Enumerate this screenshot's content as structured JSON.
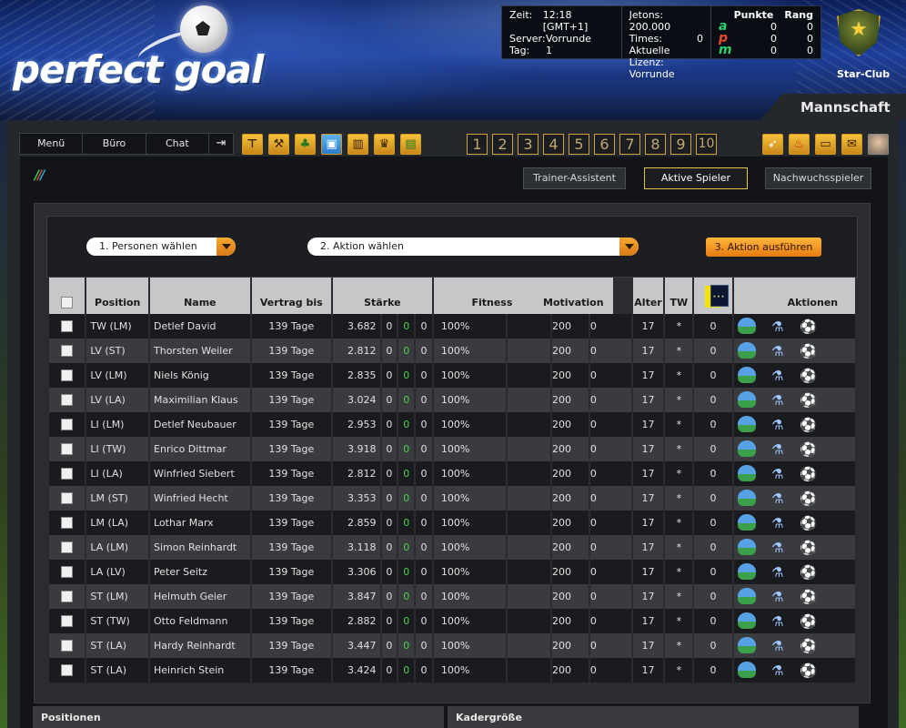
{
  "header": {
    "logo_text": "perfect goal",
    "info": {
      "time_label": "Zeit:",
      "time_value": "12:18 [GMT+1]",
      "server_label": "Server:",
      "server_value": "Vorrunde",
      "day_label": "Tag:",
      "day_value": "1",
      "chips_label": "Jetons:",
      "chips_value": "200.000",
      "times_label": "Times:",
      "times_value": "0",
      "license_label": "Aktuelle Lizenz:",
      "license_value": "Vorrunde",
      "points_header": "Punkte",
      "rank_header": "Rang",
      "scores": [
        {
          "letter": "a",
          "color": "#2bd26a",
          "points": "0",
          "rank": "0"
        },
        {
          "letter": "p",
          "color": "#e84b2a",
          "points": "0",
          "rank": "0"
        },
        {
          "letter": "m",
          "color": "#2bd26a",
          "points": "0",
          "rank": "0"
        }
      ]
    },
    "club_name": "Star-Club",
    "section_title": "Mannschaft"
  },
  "menubar": {
    "items": [
      "Menü",
      "Büro",
      "Chat"
    ],
    "logout_icon": "logout-icon"
  },
  "tool_icons": [
    "whistle-icon",
    "construction-icon",
    "clover-icon",
    "gift-icon",
    "buildings-icon",
    "crown-icon",
    "scoreboard-icon"
  ],
  "num_tabs": [
    "1",
    "2",
    "3",
    "4",
    "5",
    "6",
    "7",
    "8",
    "9",
    "10"
  ],
  "right_icons": [
    "rocket-icon",
    "fire-icon",
    "card-icon",
    "mail-icon",
    "avatar-icon"
  ],
  "sub_tabs": {
    "trainer": "Trainer-Assistent",
    "active": "Aktive Spieler",
    "youth": "Nachwuchsspieler"
  },
  "actions": {
    "select_persons": "1. Personen wählen",
    "select_action": "2. Aktion wählen",
    "execute": "3. Aktion ausführen"
  },
  "table": {
    "headers": {
      "position": "Position",
      "name": "Name",
      "contract": "Vertrag bis",
      "strength": "Stärke",
      "fitness": "Fitness",
      "motivation": "Motivation",
      "age": "Alter",
      "tw": "TW",
      "actions": "Aktionen"
    },
    "rows": [
      {
        "pos": "TW (LM)",
        "name": "Detlef David",
        "contract": "139 Tage",
        "st": "3.682",
        "s1": "0",
        "s2": "0",
        "s3": "0",
        "fit": "100%",
        "mot": "200",
        "mot2": "0",
        "age": "17",
        "tw": "*",
        "card": "0"
      },
      {
        "pos": "LV (ST)",
        "name": "Thorsten Weiler",
        "contract": "139 Tage",
        "st": "2.812",
        "s1": "0",
        "s2": "0",
        "s3": "0",
        "fit": "100%",
        "mot": "200",
        "mot2": "0",
        "age": "17",
        "tw": "*",
        "card": "0"
      },
      {
        "pos": "LV (LM)",
        "name": "Niels König",
        "contract": "139 Tage",
        "st": "2.835",
        "s1": "0",
        "s2": "0",
        "s3": "0",
        "fit": "100%",
        "mot": "200",
        "mot2": "0",
        "age": "17",
        "tw": "*",
        "card": "0"
      },
      {
        "pos": "LV (LA)",
        "name": "Maximilian Klaus",
        "contract": "139 Tage",
        "st": "3.024",
        "s1": "0",
        "s2": "0",
        "s3": "0",
        "fit": "100%",
        "mot": "200",
        "mot2": "0",
        "age": "17",
        "tw": "*",
        "card": "0"
      },
      {
        "pos": "LI (LM)",
        "name": "Detlef Neubauer",
        "contract": "139 Tage",
        "st": "2.953",
        "s1": "0",
        "s2": "0",
        "s3": "0",
        "fit": "100%",
        "mot": "200",
        "mot2": "0",
        "age": "17",
        "tw": "*",
        "card": "0"
      },
      {
        "pos": "LI (TW)",
        "name": "Enrico Dittmar",
        "contract": "139 Tage",
        "st": "3.918",
        "s1": "0",
        "s2": "0",
        "s3": "0",
        "fit": "100%",
        "mot": "200",
        "mot2": "0",
        "age": "17",
        "tw": "*",
        "card": "0"
      },
      {
        "pos": "LI (LA)",
        "name": "Winfried Siebert",
        "contract": "139 Tage",
        "st": "2.812",
        "s1": "0",
        "s2": "0",
        "s3": "0",
        "fit": "100%",
        "mot": "200",
        "mot2": "0",
        "age": "17",
        "tw": "*",
        "card": "0"
      },
      {
        "pos": "LM (ST)",
        "name": "Winfried Hecht",
        "contract": "139 Tage",
        "st": "3.353",
        "s1": "0",
        "s2": "0",
        "s3": "0",
        "fit": "100%",
        "mot": "200",
        "mot2": "0",
        "age": "17",
        "tw": "*",
        "card": "0"
      },
      {
        "pos": "LM (LA)",
        "name": "Lothar Marx",
        "contract": "139 Tage",
        "st": "2.859",
        "s1": "0",
        "s2": "0",
        "s3": "0",
        "fit": "100%",
        "mot": "200",
        "mot2": "0",
        "age": "17",
        "tw": "*",
        "card": "0"
      },
      {
        "pos": "LA (LM)",
        "name": "Simon Reinhardt",
        "contract": "139 Tage",
        "st": "3.118",
        "s1": "0",
        "s2": "0",
        "s3": "0",
        "fit": "100%",
        "mot": "200",
        "mot2": "0",
        "age": "17",
        "tw": "*",
        "card": "0"
      },
      {
        "pos": "LA (LV)",
        "name": "Peter Seitz",
        "contract": "139 Tage",
        "st": "3.306",
        "s1": "0",
        "s2": "0",
        "s3": "0",
        "fit": "100%",
        "mot": "200",
        "mot2": "0",
        "age": "17",
        "tw": "*",
        "card": "0"
      },
      {
        "pos": "ST (LM)",
        "name": "Helmuth Geier",
        "contract": "139 Tage",
        "st": "3.847",
        "s1": "0",
        "s2": "0",
        "s3": "0",
        "fit": "100%",
        "mot": "200",
        "mot2": "0",
        "age": "17",
        "tw": "*",
        "card": "0"
      },
      {
        "pos": "ST (TW)",
        "name": "Otto Feldmann",
        "contract": "139 Tage",
        "st": "2.882",
        "s1": "0",
        "s2": "0",
        "s3": "0",
        "fit": "100%",
        "mot": "200",
        "mot2": "0",
        "age": "17",
        "tw": "*",
        "card": "0"
      },
      {
        "pos": "ST (LA)",
        "name": "Hardy Reinhardt",
        "contract": "139 Tage",
        "st": "3.447",
        "s1": "0",
        "s2": "0",
        "s3": "0",
        "fit": "100%",
        "mot": "200",
        "mot2": "0",
        "age": "17",
        "tw": "*",
        "card": "0"
      },
      {
        "pos": "ST (LA)",
        "name": "Heinrich Stein",
        "contract": "139 Tage",
        "st": "3.424",
        "s1": "0",
        "s2": "0",
        "s3": "0",
        "fit": "100%",
        "mot": "200",
        "mot2": "0",
        "age": "17",
        "tw": "*",
        "card": "0"
      }
    ],
    "row_action_icons": [
      "training-icon",
      "potion-icon",
      "kick-icon"
    ]
  },
  "footer": {
    "positions": "Positionen",
    "squad_size": "Kadergröße"
  },
  "colors": {
    "accent_orange": "#f6a92e",
    "tab_active_border": "#e2c84a",
    "strength_green": "#4fd04f"
  }
}
